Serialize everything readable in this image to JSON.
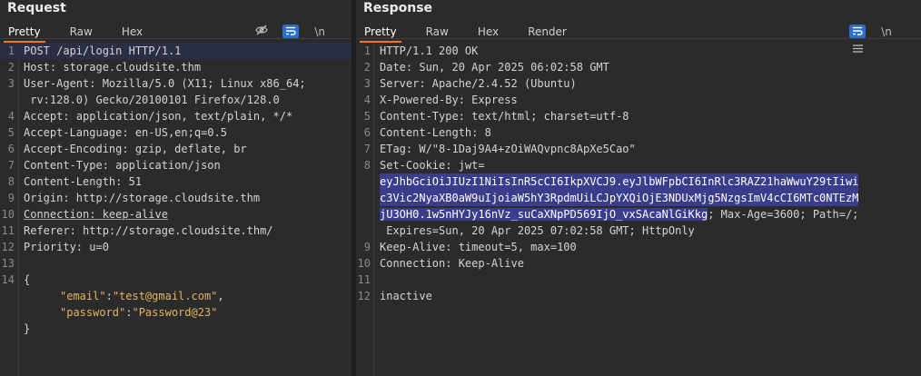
{
  "request": {
    "title": "Request",
    "tabs": [
      "Pretty",
      "Raw",
      "Hex"
    ],
    "active_tab": "Pretty",
    "lines": [
      {
        "n": "1",
        "text": "POST /api/login HTTP/1.1"
      },
      {
        "n": "2",
        "text": "Host: storage.cloudsite.thm"
      },
      {
        "n": "3",
        "text": "User-Agent: Mozilla/5.0 (X11; Linux x86_64;"
      },
      {
        "n": "",
        "text": " rv:128.0) Gecko/20100101 Firefox/128.0"
      },
      {
        "n": "4",
        "text": "Accept: application/json, text/plain, */*"
      },
      {
        "n": "5",
        "text": "Accept-Language: en-US,en;q=0.5"
      },
      {
        "n": "6",
        "text": "Accept-Encoding: gzip, deflate, br"
      },
      {
        "n": "7",
        "text": "Content-Type: application/json"
      },
      {
        "n": "8",
        "text": "Content-Length: 51"
      },
      {
        "n": "9",
        "text": "Origin: http://storage.cloudsite.thm"
      },
      {
        "n": "10",
        "text": "Connection: keep-alive"
      },
      {
        "n": "11",
        "text": "Referer: http://storage.cloudsite.thm/"
      },
      {
        "n": "12",
        "text": "Priority: u=0"
      },
      {
        "n": "13",
        "text": ""
      },
      {
        "n": "14",
        "text": "{"
      }
    ],
    "body": {
      "email_key": "\"email\"",
      "email_value": "\"test@gmail.com\"",
      "password_key": "\"password\"",
      "password_value": "\"Password@23\"",
      "close": "}"
    }
  },
  "response": {
    "title": "Response",
    "tabs": [
      "Pretty",
      "Raw",
      "Hex",
      "Render"
    ],
    "active_tab": "Pretty",
    "lines": [
      {
        "n": "1",
        "text": "HTTP/1.1 200 OK"
      },
      {
        "n": "2",
        "text": "Date: Sun, 20 Apr 2025 06:02:58 GMT"
      },
      {
        "n": "3",
        "text": "Server: Apache/2.4.52 (Ubuntu)"
      },
      {
        "n": "4",
        "text": "X-Powered-By: Express"
      },
      {
        "n": "5",
        "text": "Content-Type: text/html; charset=utf-8"
      },
      {
        "n": "6",
        "text": "Content-Length: 8"
      },
      {
        "n": "7",
        "text": "ETag: W/\"8-1Daj9A4+zOiWAQvpnc8ApXe5Cao\""
      },
      {
        "n": "8",
        "text": "Set-Cookie: jwt="
      }
    ],
    "jwt_lines": [
      "eyJhbGciOiJIUzI1NiIsInR5cCI6IkpXVCJ9.eyJlbWFpbCI6InRlc3RAZ21haWwuY29tIiwi",
      "c3Vic2NyaXB0aW9uIjoiaW5hY3RpdmUiLCJpYXQiOjE3NDUxMjg5NzgsImV4cCI6MTc0NTEzM",
      "jU3OH0.1w5nHYJy16nVz_suCaXNpPD569IjO_vxSAcaNlGiKkg"
    ],
    "cookie_rest": "; Max-Age=3600; Path=/;",
    "cookie_expires": " Expires=Sun, 20 Apr 2025 07:02:58 GMT; HttpOnly",
    "tail_lines": [
      {
        "n": "9",
        "text": "Keep-Alive: timeout=5, max=100"
      },
      {
        "n": "10",
        "text": "Connection: Keep-Alive"
      },
      {
        "n": "11",
        "text": ""
      },
      {
        "n": "12",
        "text": "inactive"
      }
    ]
  },
  "icons": {
    "hide": "eye-off-icon",
    "wrap": "wrap-lines-icon",
    "newline": "\\n",
    "menu": "hamburger-menu-icon"
  },
  "colors": {
    "accent_tab": "#e8782b",
    "tool_active": "#2d6fd0",
    "selection": "#3a3c8c"
  }
}
